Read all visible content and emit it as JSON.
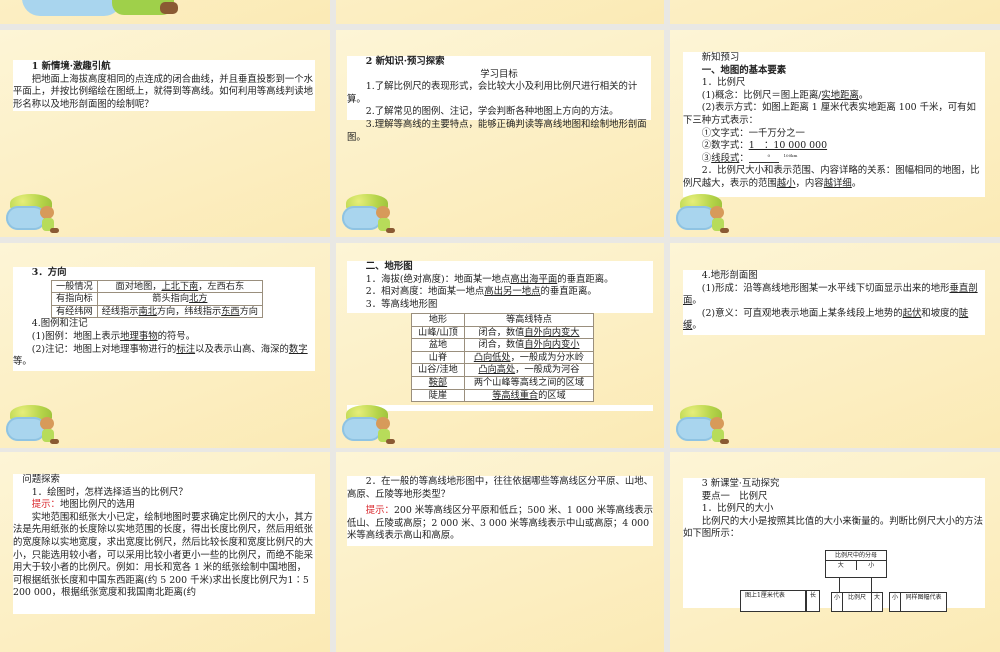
{
  "slides": [
    {
      "id": "s1",
      "paragraphs": [
        [
          "1 新情境·激趣引航"
        ],
        [
          "把地面上海拔高度相同的点连成的闭合曲线，并且垂直投影到一个水平面上，并按比例缩绘在图纸上，就得到等高线。如何利用等高线判读地形名称以及地形剖面图的绘制呢？"
        ]
      ]
    },
    {
      "id": "s2",
      "heading": "2 新知识·预习探索",
      "subheading": "学习目标",
      "paragraphs": [
        [
          "1.了解比例尺的表现形式，会比较大小及利用比例尺进行相关的计算。"
        ],
        [
          "2.了解常见的图例、注记，学会判断各种地图上方向的方法。"
        ],
        [
          "3.理解等高线的主要特点，能够正确判读等高线地图和绘制地形剖面图。"
        ]
      ]
    },
    {
      "id": "s3",
      "paragraphs": [
        [
          "新知预习"
        ],
        [
          "一、地图的基本要素"
        ],
        [
          "1．比例尺"
        ],
        [
          "(1)概念：比例尺＝图上距离/",
          {
            "u": "实地距离"
          },
          "。"
        ],
        [
          "(2)表示方式：如图上距离 1 厘米代表实地距离 100 千米，可有如下三种方式表示："
        ],
        [
          "①文字式：一千万分之一"
        ],
        [
          "②数字式：",
          {
            "u": "1　：10 000 000"
          }
        ],
        [
          "③",
          {
            "u": "线段式"
          },
          "："
        ],
        [
          "2．比例尺大小和表示范围、内容详略的关系：图幅相同的地图，比例尺越大，表示的范围",
          {
            "u": "越小"
          },
          "，内容",
          {
            "u": "越详细"
          },
          "。"
        ]
      ],
      "scale_bar": {
        "start": "0",
        "end": "100km"
      }
    },
    {
      "id": "s4",
      "heading": "3．方向",
      "table": [
        [
          [
            "一般情况"
          ],
          [
            "面对地图，",
            {
              "u": "上北下南"
            },
            "，左西右东"
          ]
        ],
        [
          [
            "有指向标"
          ],
          [
            "箭头指向",
            {
              "u": "北方"
            }
          ]
        ],
        [
          [
            "有经纬网"
          ],
          [
            "经线指示",
            {
              "u": "南北"
            },
            "方向，纬线指示",
            {
              "u": "东西"
            },
            "方向"
          ]
        ]
      ],
      "paragraphs": [
        [
          "4.图例和注记"
        ],
        [
          "(1)图例：地图上表示",
          {
            "u": "地理事物"
          },
          "的符号。"
        ],
        [
          "(2)注记：地图上对地理事物进行的",
          {
            "u": "标注"
          },
          "以及表示山高、海深的",
          {
            "u": "数字"
          },
          "等。"
        ]
      ]
    },
    {
      "id": "s5",
      "paragraphs": [
        [
          "二、地形图"
        ],
        [
          "1．海拔(绝对高度)：地面某一地点",
          {
            "u": "高出海平面"
          },
          "的垂直距离。"
        ],
        [
          "2．相对高度：地面某一地点",
          {
            "u": "高出另一地点"
          },
          "的垂直距离。"
        ],
        [
          "3．等高线地形图"
        ]
      ],
      "table": [
        [
          [
            "地形"
          ],
          [
            "等高线特点"
          ]
        ],
        [
          [
            "山峰/山顶"
          ],
          [
            "闭合，数值",
            {
              "u": "自外向内变大"
            }
          ]
        ],
        [
          [
            "盆地"
          ],
          [
            "闭合，数值",
            {
              "u": "自外向内变小"
            }
          ]
        ],
        [
          [
            "山脊"
          ],
          [
            {
              "u": "凸向低处"
            },
            "，一般成为分水岭"
          ]
        ],
        [
          [
            "山谷/洼地"
          ],
          [
            {
              "u": "凸向高处"
            },
            "，一般成为河谷"
          ]
        ],
        [
          [
            {
              "u": "鞍部"
            }
          ],
          [
            "两个山峰等高线之间的区域"
          ]
        ],
        [
          [
            "陡崖"
          ],
          [
            {
              "u": "等高线重合"
            },
            "的区域"
          ]
        ]
      ]
    },
    {
      "id": "s6",
      "paragraphs": [
        [
          "4.地形剖面图"
        ],
        [
          "(1)形成：沿等高线地形图某一水平线下切面显示出来的地形",
          {
            "u": "垂直剖面"
          },
          "。"
        ],
        [
          "(2)意义：可直观地表示地面上某条线段上地势的",
          {
            "u": "起伏"
          },
          "和坡度的",
          {
            "u": "陡缓"
          },
          "。"
        ]
      ]
    },
    {
      "id": "s7",
      "paragraphs": [
        [
          "问题探索"
        ],
        [
          "1．绘图时，怎样选择适当的比例尺？"
        ],
        [
          {
            "r": "提示："
          },
          "地图比例尺的选用"
        ],
        [
          "实地范围和纸张大小已定，绘制地图时要求确定比例尺的大小，其方法是先用纸张的长度除以实地范围的长度，得出长度比例尺，然后用纸张的宽度除以实地宽度，求出宽度比例尺，然后比较长度和宽度比例尺的大小，只能选用较小者，可以采用比较小者更小一些的比例尺，而绝不能采用大于较小者的比例尺。例如：用长和宽各 1 米的纸张绘制中国地图，可根据纸张长度和中国东西距离(约 5 200 千米)求出长度比例尺为1∶5 200 000，根据纸张宽度和我国南北距离(约"
        ]
      ]
    },
    {
      "id": "s8",
      "paragraphs": [
        [
          "2．在一般的等高线地形图中，往往依据哪些等高线区分平原、山地、高原、丘陵等地形类型？"
        ],
        [
          {
            "r": "提示："
          },
          "200 米等高线区分平原和低丘；500 米、1 000 米等高线表示低山、丘陵或高原；2 000 米、3 000 米等高线表示中山或高原；4 000 米等高线表示高山和高原。"
        ]
      ]
    },
    {
      "id": "s9",
      "paragraphs": [
        [
          "3 新课堂·互动探究"
        ],
        [
          "要点一　比例尺"
        ],
        [
          "1．比例尺的大小"
        ],
        [
          "比例尺的大小是按照其比值的大小来衡量的。判断比例尺大小的方法如下图所示："
        ]
      ],
      "diagram": {
        "denominator": "比例尺中的分母",
        "big": "大",
        "small": "小",
        "left_label": "图上1厘米代表",
        "left_value": "长",
        "mid_left": "小",
        "mid": "比例尺",
        "mid_right": "大",
        "right_value": "小",
        "right_label": "同样图幅代表"
      }
    }
  ]
}
